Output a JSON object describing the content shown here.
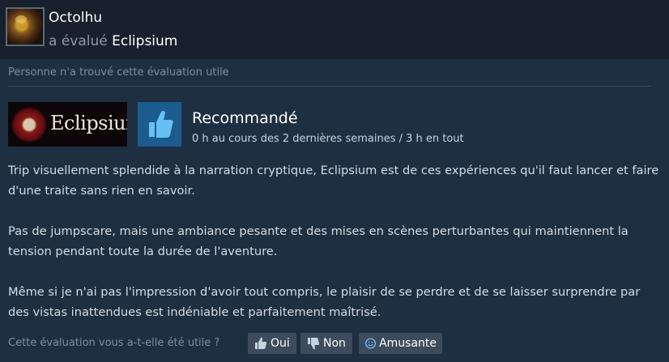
{
  "review": {
    "author": "Octolhu",
    "action": "a évalué",
    "game": "Eclipsium",
    "helpful_status": "Personne n'a trouvé cette évaluation utile",
    "game_capsule_text": "Eclipsium",
    "recommendation": "Recommandé",
    "playtime": "0 h au cours des 2 dernières semaines / 3 h en tout",
    "paragraphs": [
      "Trip visuellement splendide à la narration cryptique, Eclipsium est de ces expériences qu'il faut lancer et faire d'une traite sans rien en savoir.",
      "Pas de jumpscare, mais une ambiance pesante et des mises en scènes perturbantes qui maintiennent la tension pendant toute la durée de l'aventure.",
      "Même si je n'ai pas l'impression d'avoir tout compris, le plaisir de se perdre et de se laisser surprendre par des vistas inattendues est indéniable et parfaitement maîtrisé."
    ]
  },
  "footer": {
    "question": "Cette évaluation vous a-t-elle été utile ?",
    "yes_label": "Oui",
    "no_label": "Non",
    "funny_label": "Amusante"
  },
  "icons": {
    "recommend": "thumbs-up-icon",
    "yes": "thumbs-up-icon",
    "no": "thumbs-down-icon",
    "funny": "smiley-icon"
  },
  "colors": {
    "background": "#1e2f42",
    "header": "#17202c",
    "thumb_box": "#1c5b8d",
    "thumb": "#66c0f4",
    "vote_button": "#3d4b5c"
  }
}
